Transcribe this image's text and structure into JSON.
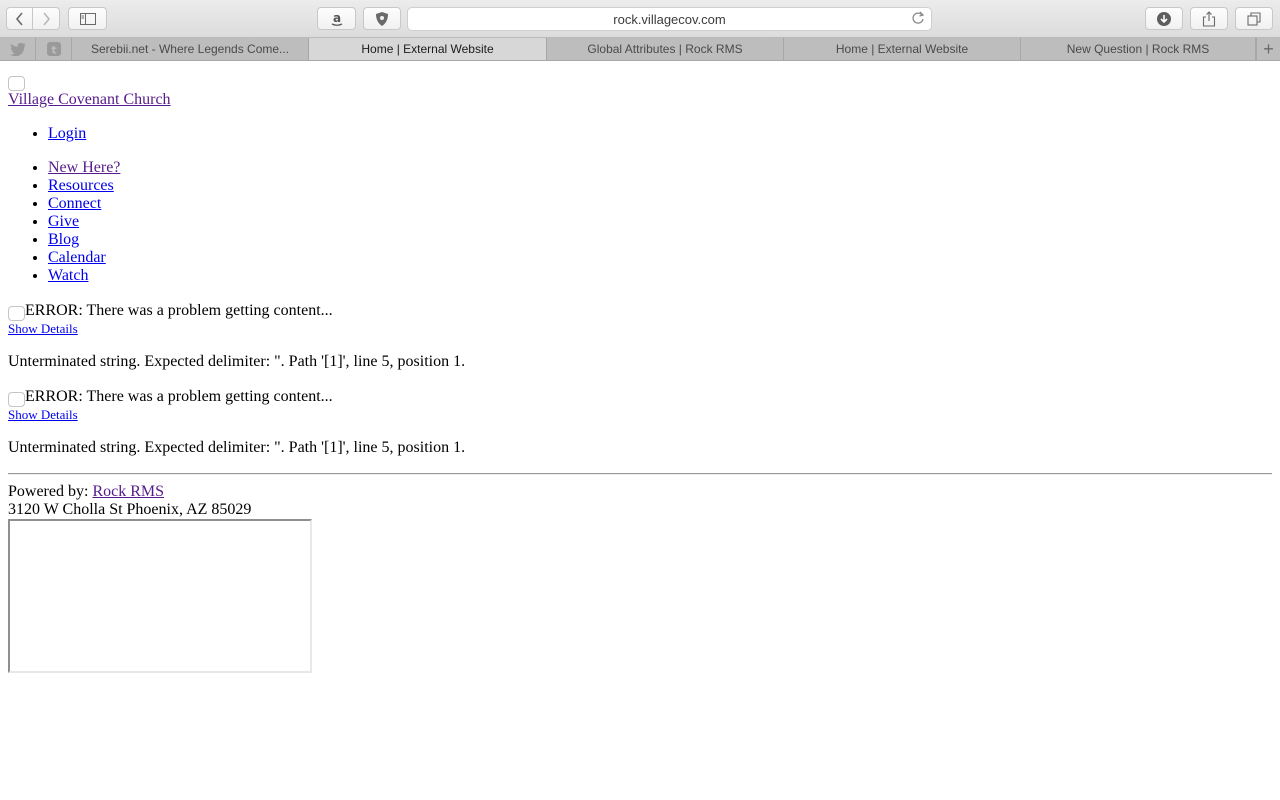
{
  "browser": {
    "url": "rock.villagecov.com",
    "toolbar_icons": {
      "back": "chevron-left-icon",
      "forward": "chevron-right-icon",
      "sidebar": "sidebar-icon",
      "amazon": "amazon-icon",
      "shield": "shield-icon",
      "reload": "reload-icon",
      "download": "download-icon",
      "share": "share-icon",
      "tabs": "tabs-overview-icon"
    },
    "pinned_tabs": [
      "twitter",
      "tumblr"
    ],
    "tabs": [
      {
        "label": "Serebii.net - Where Legends Come...",
        "active": false
      },
      {
        "label": "Home | External Website",
        "active": true
      },
      {
        "label": "Global Attributes | Rock RMS",
        "active": false
      },
      {
        "label": "Home | External Website",
        "active": false
      },
      {
        "label": "New Question | Rock RMS",
        "active": false
      }
    ],
    "new_tab_label": "+"
  },
  "page": {
    "brand": "Village Covenant Church",
    "account_nav": [
      {
        "label": "Login"
      }
    ],
    "main_nav": [
      {
        "label": "New Here?",
        "visited": true
      },
      {
        "label": "Resources",
        "visited": false
      },
      {
        "label": "Connect",
        "visited": false
      },
      {
        "label": "Give",
        "visited": false
      },
      {
        "label": "Blog",
        "visited": false
      },
      {
        "label": "Calendar",
        "visited": false
      },
      {
        "label": "Watch",
        "visited": false
      }
    ],
    "errors": [
      {
        "title": "ERROR: There was a problem getting content...",
        "show_details": "Show Details",
        "detail": "Unterminated string. Expected delimiter: \". Path '[1]', line 5, position 1."
      },
      {
        "title": "ERROR: There was a problem getting content...",
        "show_details": "Show Details",
        "detail": "Unterminated string. Expected delimiter: \". Path '[1]', line 5, position 1."
      }
    ],
    "footer": {
      "powered_by_label": "Powered by: ",
      "powered_by_link": "Rock RMS",
      "address": "3120 W Cholla St Phoenix, AZ 85029"
    }
  },
  "colors": {
    "link": "#0000ee",
    "visited_link": "#551a8b"
  }
}
